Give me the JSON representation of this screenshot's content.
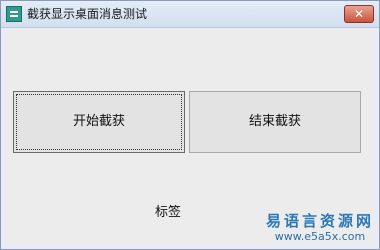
{
  "window": {
    "title": "截获显示桌面消息测试",
    "close_symbol": "✕"
  },
  "buttons": {
    "start_label": "开始截获",
    "end_label": "结束截获"
  },
  "label": {
    "text": "标签"
  },
  "watermark": {
    "chinese": "易语言资源网",
    "url": "www.e5a5x.com"
  },
  "icons": {
    "app": "app-icon",
    "close": "close-icon"
  }
}
